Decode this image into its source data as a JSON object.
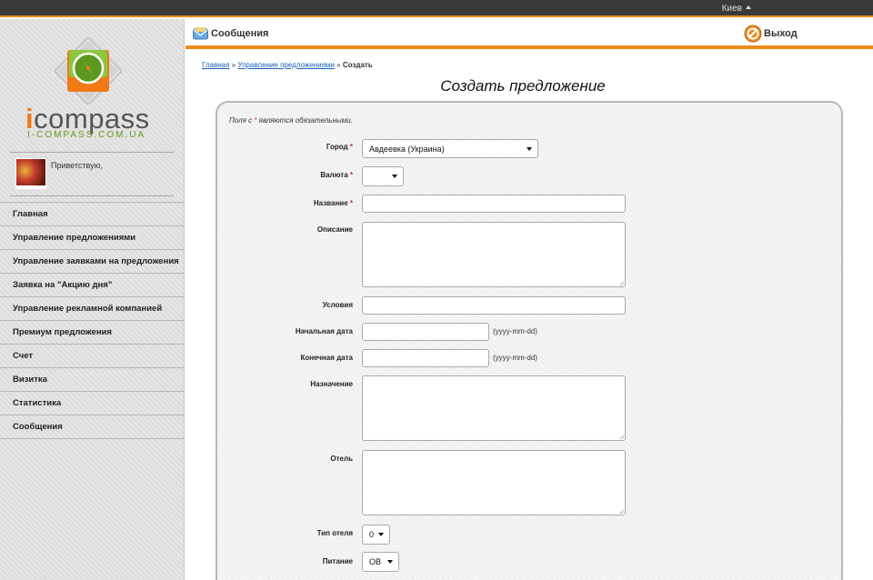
{
  "topbar": {
    "city": "Киев"
  },
  "logo": {
    "i": "i",
    "rest": "compass",
    "sub": "I-COMPASS.COM.UA"
  },
  "user": {
    "greeting": "Приветствую,"
  },
  "menu": [
    "Главная",
    "Управление предложениями",
    "Управление заявками на предложения",
    "Заявка на \"Акцию дня\"",
    "Управление рекламной компанией",
    "Премиум предложения",
    "Счет",
    "Визитка",
    "Статистика",
    "Сообщения"
  ],
  "header": {
    "messages": "Сообщения",
    "exit": "Выход"
  },
  "breadcrumb": {
    "home": "Главная",
    "sep1": "»",
    "offers": "Управление предложениями",
    "sep2": "»",
    "current": "Создать"
  },
  "page_title": "Создать предложение",
  "form": {
    "required_note_pre": "Поля с",
    "required_note_star": "*",
    "required_note_post": "являются обязательными.",
    "star": "*",
    "city_label": "Город",
    "city_value": "Авдеевка (Украина)",
    "currency_label": "Валюта",
    "currency_value": "",
    "name_label": "Название",
    "description_label": "Описание",
    "conditions_label": "Условия",
    "start_date_label": "Начальная дата",
    "end_date_label": "Конечная дата",
    "date_hint": "(yyyy-mm-dd)",
    "purpose_label": "Назначение",
    "hotel_label": "Отель",
    "hotel_type_label": "Тип отеля",
    "hotel_type_value": "0",
    "food_label": "Питание",
    "food_value": "OB"
  },
  "colors": {
    "accent": "#f08a1d",
    "topbar": "#3a3a3a",
    "link": "#1a63b8",
    "required": "#d22222"
  }
}
